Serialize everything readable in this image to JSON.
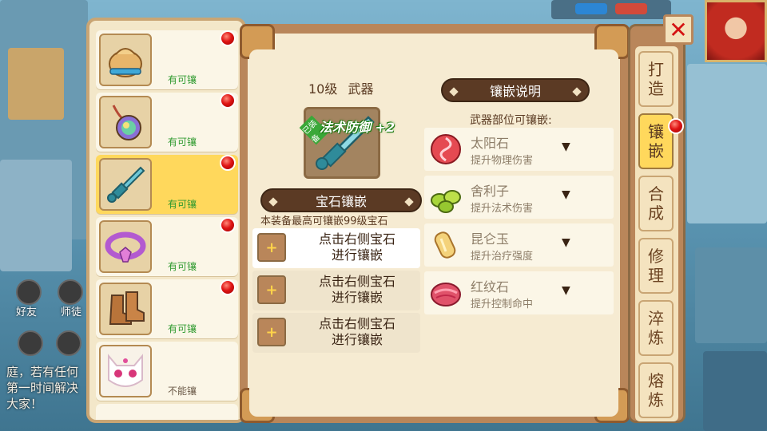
{
  "chat": {
    "text": "庭，若有任何第一时间解决大家！",
    "line0": "庭，若有任何",
    "line1": "第一时间解决",
    "line2": "大家！"
  },
  "hud": {
    "friends_label": "好友",
    "master_label": "师徒"
  },
  "equip_list": [
    {
      "name": "pouch",
      "status": "有可镶",
      "alert": true
    },
    {
      "name": "amulet",
      "status": "有可镶",
      "alert": true
    },
    {
      "name": "weapon",
      "status": "有可镶",
      "alert": true,
      "selected": true
    },
    {
      "name": "belt",
      "status": "有可镶",
      "alert": true
    },
    {
      "name": "boots",
      "status": "有可镶",
      "alert": true
    },
    {
      "name": "pet",
      "status": "不能镶",
      "alert": false
    }
  ],
  "equipment": {
    "level_text": "10级",
    "type_text": "武器",
    "enhance_label": "法术防御 +2",
    "equipped_badge": "已装备"
  },
  "gem_section": {
    "header": "宝石镶嵌",
    "note": "本装备最高可镶嵌99级宝石",
    "slots": [
      {
        "text_line1": "点击右侧宝石",
        "text_line2": "进行镶嵌",
        "plus": "+"
      },
      {
        "text_line1": "点击右侧宝石",
        "text_line2": "进行镶嵌",
        "plus": "+"
      },
      {
        "text_line1": "点击右侧宝石",
        "text_line2": "进行镶嵌",
        "plus": "+"
      }
    ]
  },
  "info_section": {
    "header": "镶嵌说明",
    "subheader": "武器部位可镶嵌:",
    "gems": [
      {
        "name": "太阳石",
        "desc": "提升物理伤害",
        "arrow": "▼"
      },
      {
        "name": "舍利子",
        "desc": "提升法术伤害",
        "arrow": "▼"
      },
      {
        "name": "昆仑玉",
        "desc": "提升治疗强度",
        "arrow": "▼"
      },
      {
        "name": "红纹石",
        "desc": "提升控制命中",
        "arrow": "▼"
      }
    ]
  },
  "tabs": [
    {
      "line1": "打",
      "line2": "造"
    },
    {
      "line1": "镶",
      "line2": "嵌",
      "active": true
    },
    {
      "line1": "合",
      "line2": "成"
    },
    {
      "line1": "修",
      "line2": "理"
    },
    {
      "line1": "淬",
      "line2": "炼"
    },
    {
      "line1": "熔",
      "line2": "炼"
    }
  ],
  "close_label": "✕"
}
